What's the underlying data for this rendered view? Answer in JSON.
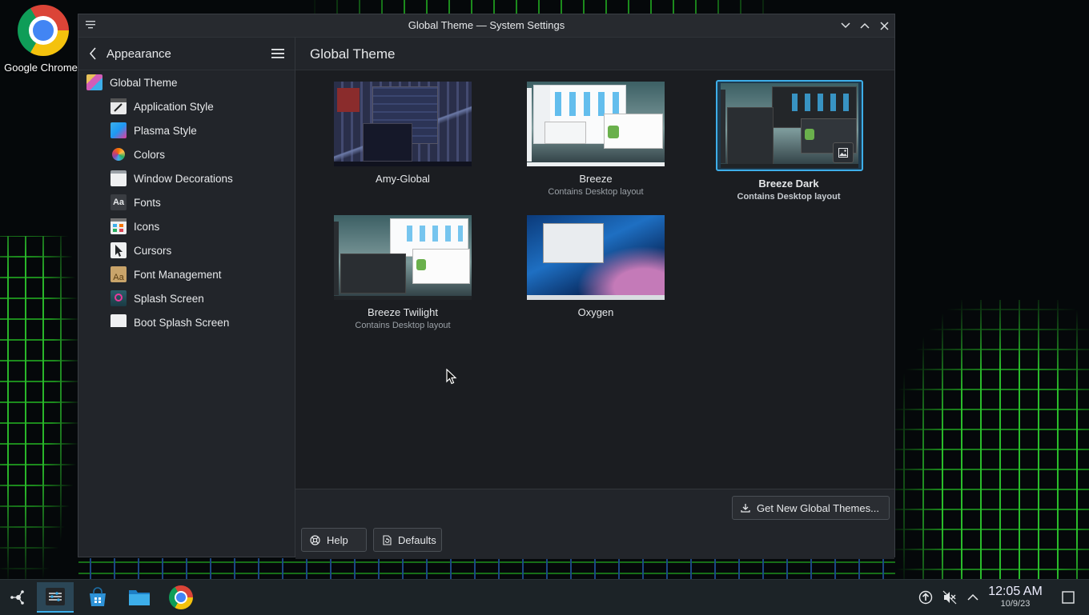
{
  "desktop": {
    "icon_label": "Google Chrome"
  },
  "window": {
    "title": "Global Theme — System Settings"
  },
  "sidebar": {
    "title": "Appearance",
    "items": [
      {
        "label": "Global Theme",
        "icon": "global-theme-icon",
        "color": "#d35db7"
      },
      {
        "label": "Application Style",
        "icon": "application-style-icon",
        "color": "#eaeaea"
      },
      {
        "label": "Plasma Style",
        "icon": "plasma-style-icon",
        "color": "#3daee9"
      },
      {
        "label": "Colors",
        "icon": "colors-icon",
        "color": "#f67400"
      },
      {
        "label": "Window Decorations",
        "icon": "window-decorations-icon",
        "color": "#eff0f1"
      },
      {
        "label": "Fonts",
        "icon": "fonts-icon",
        "color": "#4d4d4d"
      },
      {
        "label": "Icons",
        "icon": "icons-icon",
        "color": "#eff0f1"
      },
      {
        "label": "Cursors",
        "icon": "cursors-icon",
        "color": "#eff0f1"
      },
      {
        "label": "Font Management",
        "icon": "font-management-icon",
        "color": "#c9a46a"
      },
      {
        "label": "Splash Screen",
        "icon": "splash-screen-icon",
        "color": "#3d7a74"
      },
      {
        "label": "Boot Splash Screen",
        "icon": "boot-splash-screen-icon",
        "color": "#eff0f1"
      }
    ]
  },
  "main": {
    "title": "Global Theme",
    "themes": [
      {
        "name": "Amy-Global",
        "sub": ""
      },
      {
        "name": "Breeze",
        "sub": "Contains Desktop layout"
      },
      {
        "name": "Breeze Dark",
        "sub": "Contains Desktop layout",
        "selected": true
      },
      {
        "name": "Breeze Twilight",
        "sub": "Contains Desktop layout"
      },
      {
        "name": "Oxygen",
        "sub": ""
      }
    ]
  },
  "footer": {
    "get_new": "Get New Global Themes...",
    "help": "Help",
    "defaults": "Defaults"
  },
  "clock": {
    "time": "12:05 AM",
    "date": "10/9/23"
  },
  "colors": {
    "accent": "#3daee9",
    "window_bg": "#1f2226"
  }
}
